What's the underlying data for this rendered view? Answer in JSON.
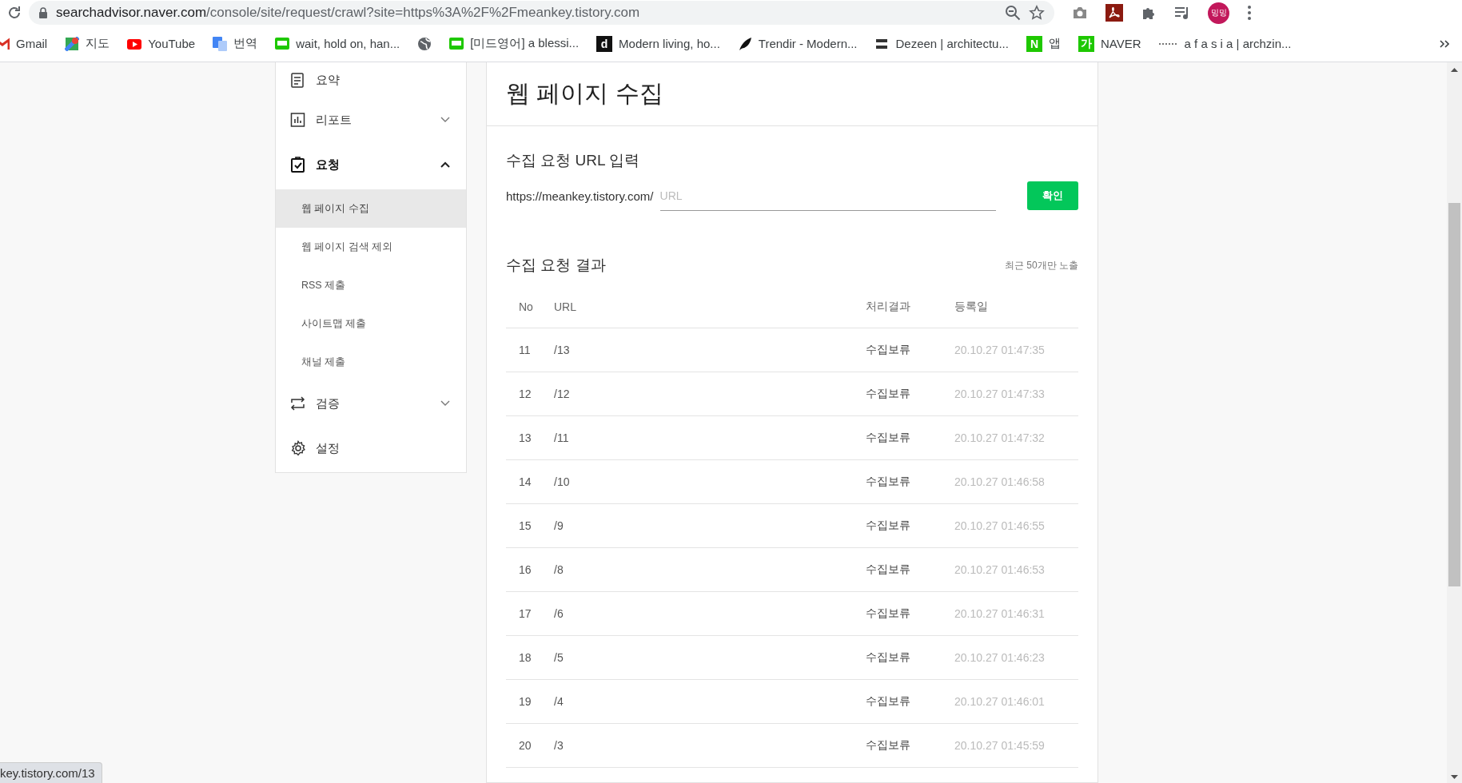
{
  "browser": {
    "url_domain": "searchadvisor.naver.com",
    "url_path": "/console/site/request/crawl?site=https%3A%2F%2Fmeankey.tistory.com",
    "profile": "밍밍"
  },
  "bookmarks": [
    {
      "label": "Gmail",
      "kind": "gmail"
    },
    {
      "label": "지도",
      "kind": "maps"
    },
    {
      "label": "YouTube",
      "kind": "youtube"
    },
    {
      "label": "번역",
      "kind": "translate"
    },
    {
      "label": "wait, hold on, han...",
      "kind": "blog"
    },
    {
      "kind": "globe"
    },
    {
      "label": "[미드영어] a blessi...",
      "kind": "blog"
    },
    {
      "label": "Modern living, ho...",
      "kind": "letter",
      "glyph": "d",
      "color": "#111111"
    },
    {
      "label": "Trendir - Modern...",
      "kind": "feather"
    },
    {
      "label": "Dezeen | architectu...",
      "kind": "zeen"
    },
    {
      "label": "앱",
      "kind": "letter",
      "glyph": "N",
      "color": "#1ec800"
    },
    {
      "label": "NAVER",
      "kind": "letter",
      "glyph": "가",
      "color": "#1ec800"
    },
    {
      "label": "a f a s i a | archzin...",
      "kind": "dots"
    }
  ],
  "sidebar": {
    "items": [
      {
        "label": "요약",
        "kind": "summary"
      },
      {
        "label": "리포트",
        "kind": "report",
        "expanded": false
      },
      {
        "label": "요청",
        "kind": "request",
        "expanded": true,
        "children": [
          {
            "label": "웹 페이지 수집",
            "selected": true
          },
          {
            "label": "웹 페이지 검색 제외",
            "selected": false
          },
          {
            "label": "RSS 제출",
            "selected": false
          },
          {
            "label": "사이트맵 제출",
            "selected": false
          },
          {
            "label": "채널 제출",
            "selected": false
          }
        ]
      },
      {
        "label": "검증",
        "kind": "verify",
        "expanded": false
      },
      {
        "label": "설정",
        "kind": "settings"
      }
    ]
  },
  "page": {
    "title": "웹 페이지 수집",
    "request": {
      "heading": "수집 요청 URL 입력",
      "prefix": "https://meankey.tistory.com/",
      "placeholder": "URL",
      "button": "확인"
    },
    "results": {
      "heading": "수집 요청 결과",
      "note": "최근 50개만 노출",
      "columns": [
        "No",
        "URL",
        "처리결과",
        "등록일"
      ],
      "rows": [
        [
          "11",
          "/13",
          "수집보류",
          "20.10.27 01:47:35"
        ],
        [
          "12",
          "/12",
          "수집보류",
          "20.10.27 01:47:33"
        ],
        [
          "13",
          "/11",
          "수집보류",
          "20.10.27 01:47:32"
        ],
        [
          "14",
          "/10",
          "수집보류",
          "20.10.27 01:46:58"
        ],
        [
          "15",
          "/9",
          "수집보류",
          "20.10.27 01:46:55"
        ],
        [
          "16",
          "/8",
          "수집보류",
          "20.10.27 01:46:53"
        ],
        [
          "17",
          "/6",
          "수집보류",
          "20.10.27 01:46:31"
        ],
        [
          "18",
          "/5",
          "수집보류",
          "20.10.27 01:46:23"
        ],
        [
          "19",
          "/4",
          "수집보류",
          "20.10.27 01:46:01"
        ],
        [
          "20",
          "/3",
          "수집보류",
          "20.10.27 01:45:59"
        ]
      ]
    }
  },
  "status_bubble": "key.tistory.com/13"
}
